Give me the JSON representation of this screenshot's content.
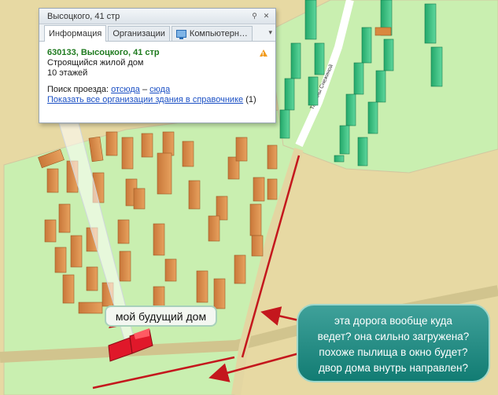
{
  "popup": {
    "title": "Высоцкого, 41 стр",
    "tabs": [
      {
        "label": "Информация",
        "active": true
      },
      {
        "label": "Организации",
        "active": false
      },
      {
        "label": "Компьютерн…",
        "active": false
      }
    ],
    "address": "630133, Высоцкого, 41 стр",
    "description": "Строящийся жилой дом",
    "floors": "10 этажей",
    "route_prefix": "Поиск проезда:",
    "route_from": "отсюда",
    "route_dash": "–",
    "route_to": "сюда",
    "show_all_link": "Показать все организации здания в справочнике",
    "show_all_count": "(1)"
  },
  "map": {
    "street_label": "Татьяны Снежиной"
  },
  "notes": {
    "small": "мой будущий дом",
    "big": [
      "эта дорога вообще куда",
      "ведет? она сильно загружена?",
      "похоже пылища в окно будет?",
      "двор дома внутрь направлен?"
    ]
  },
  "colors": {
    "background": "#e7d9a3",
    "park": "#c9efb0",
    "building": "#d9883f",
    "building_new": "#4ac78a",
    "target_building": "#e0182a",
    "arrow": "#c4171d"
  }
}
